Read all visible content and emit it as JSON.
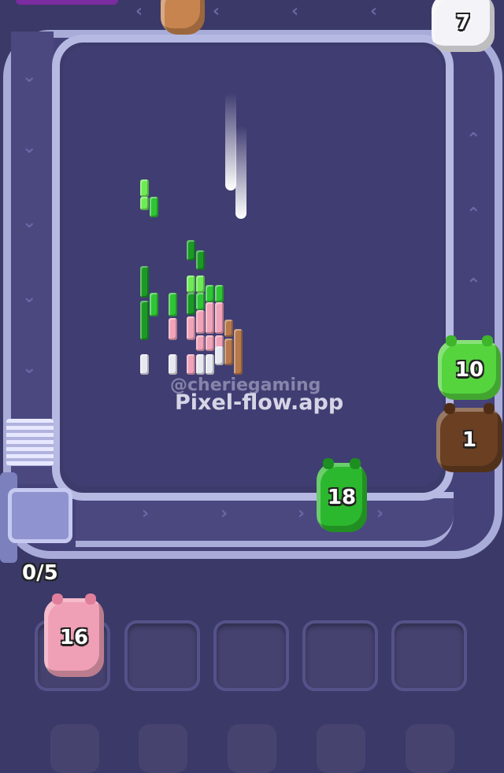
{
  "game": {
    "slot_counter": "0/5",
    "watermark_handle": "@cheriegaming",
    "watermark_site": "Pixel-flow.app"
  },
  "shooters": {
    "top_white": {
      "count": "7",
      "color": "#f4f4f8"
    },
    "right_green": {
      "count": "10",
      "color": "#55d43e"
    },
    "right_brown": {
      "count": "1",
      "color": "#6a3f22"
    },
    "track_green": {
      "count": "18",
      "color": "#2cb82e"
    },
    "slot_pink": {
      "count": "16",
      "color": "#f0a0b6"
    }
  },
  "colors": {
    "background": "#3b3968",
    "track": "#a9acd8",
    "pixel_green": "#2fc536",
    "pixel_pink": "#f0a3b9",
    "pixel_white": "#e8e8f0",
    "pixel_brown": "#b7784b"
  }
}
